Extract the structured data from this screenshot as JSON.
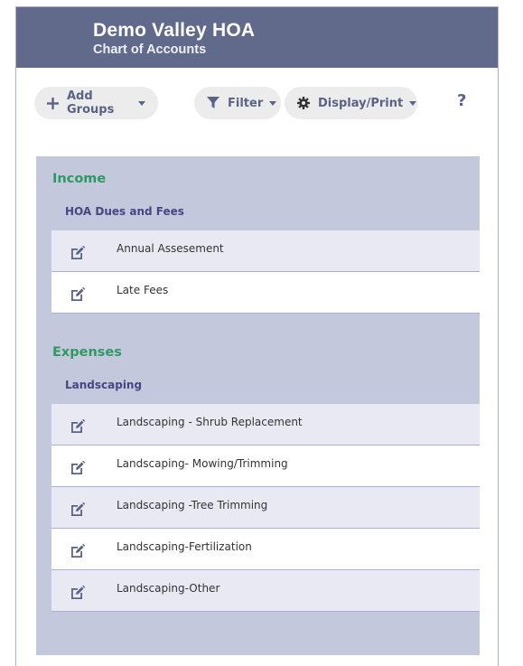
{
  "header": {
    "title": "Demo Valley HOA",
    "subtitle": "Chart of Accounts"
  },
  "toolbar": {
    "add_groups_label": "Add Groups",
    "filter_label": "Filter",
    "display_print_label": "Display/Print",
    "help_label": "?"
  },
  "categories": [
    {
      "name": "Income",
      "groups": [
        {
          "name": "HOA Dues and Fees",
          "accounts": [
            "Annual Assesement",
            "Late Fees"
          ]
        }
      ]
    },
    {
      "name": "Expenses",
      "groups": [
        {
          "name": "Landscaping",
          "accounts": [
            "Landscaping - Shrub Replacement",
            "Landscaping- Mowing/Trimming",
            "Landscaping -Tree Trimming",
            "Landscaping-Fertilization",
            "Landscaping-Other"
          ]
        }
      ]
    }
  ],
  "colors": {
    "header_bg": "#626a8b",
    "category_green": "#2e9a62",
    "group_purple": "#4a4580",
    "panel_bg": "#c4c8dd"
  }
}
